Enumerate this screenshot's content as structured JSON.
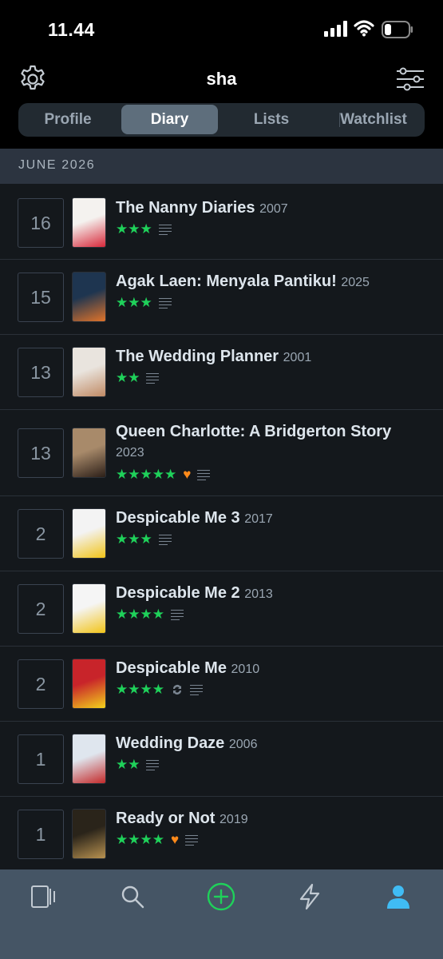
{
  "status_bar": {
    "time": "11.44"
  },
  "header": {
    "profile_name": "sha"
  },
  "tabs": [
    {
      "label": "Profile",
      "active": false
    },
    {
      "label": "Diary",
      "active": true
    },
    {
      "label": "Lists",
      "active": false
    },
    {
      "label": "Watchlist",
      "active": false
    }
  ],
  "section": {
    "month": "JUNE 2026"
  },
  "entries": [
    {
      "day": "16",
      "title": "The Nanny Diaries",
      "year": "2007",
      "stars": "★★★",
      "liked": false,
      "rewatch": false,
      "review": true,
      "poster_colors": [
        "#f4f2ef",
        "#d8283a"
      ]
    },
    {
      "day": "15",
      "title": "Agak Laen: Menyala Pantiku!",
      "year": "2025",
      "stars": "★★★",
      "liked": false,
      "rewatch": false,
      "review": true,
      "poster_colors": [
        "#1e3550",
        "#e0732a"
      ]
    },
    {
      "day": "13",
      "title": "The Wedding Planner",
      "year": "2001",
      "stars": "★★",
      "liked": false,
      "rewatch": false,
      "review": true,
      "poster_colors": [
        "#e9e4de",
        "#c08a64"
      ]
    },
    {
      "day": "13",
      "title": "Queen Charlotte: A Bridgerton Story",
      "year": "2023",
      "stars": "★★★★★",
      "liked": true,
      "rewatch": false,
      "review": true,
      "poster_colors": [
        "#a88a6a",
        "#2c1f18"
      ]
    },
    {
      "day": "2",
      "title": "Despicable Me 3",
      "year": "2017",
      "stars": "★★★",
      "liked": false,
      "rewatch": false,
      "review": true,
      "poster_colors": [
        "#f3f3f3",
        "#f2c418"
      ]
    },
    {
      "day": "2",
      "title": "Despicable Me 2",
      "year": "2013",
      "stars": "★★★★",
      "liked": false,
      "rewatch": false,
      "review": true,
      "poster_colors": [
        "#f5f5f5",
        "#f2c418"
      ]
    },
    {
      "day": "2",
      "title": "Despicable Me",
      "year": "2010",
      "stars": "★★★★",
      "liked": false,
      "rewatch": true,
      "review": true,
      "poster_colors": [
        "#c8242a",
        "#f3d21c"
      ]
    },
    {
      "day": "1",
      "title": "Wedding Daze",
      "year": "2006",
      "stars": "★★",
      "liked": false,
      "rewatch": false,
      "review": true,
      "poster_colors": [
        "#dfe6ee",
        "#c42a2a"
      ]
    },
    {
      "day": "1",
      "title": "Ready or Not",
      "year": "2019",
      "stars": "★★★★",
      "liked": true,
      "rewatch": false,
      "review": true,
      "poster_colors": [
        "#2a241a",
        "#b89250"
      ]
    }
  ],
  "tab_bar": [
    {
      "icon": "films-icon",
      "active": false
    },
    {
      "icon": "search-icon",
      "active": false
    },
    {
      "icon": "add-icon",
      "active": false
    },
    {
      "icon": "activity-icon",
      "active": false
    },
    {
      "icon": "profile-icon",
      "active": true
    }
  ],
  "colors": {
    "accent_green": "#1fd15a",
    "heart_orange": "#ff8a1a",
    "active_blue": "#40bcf4",
    "background": "#14181c"
  }
}
